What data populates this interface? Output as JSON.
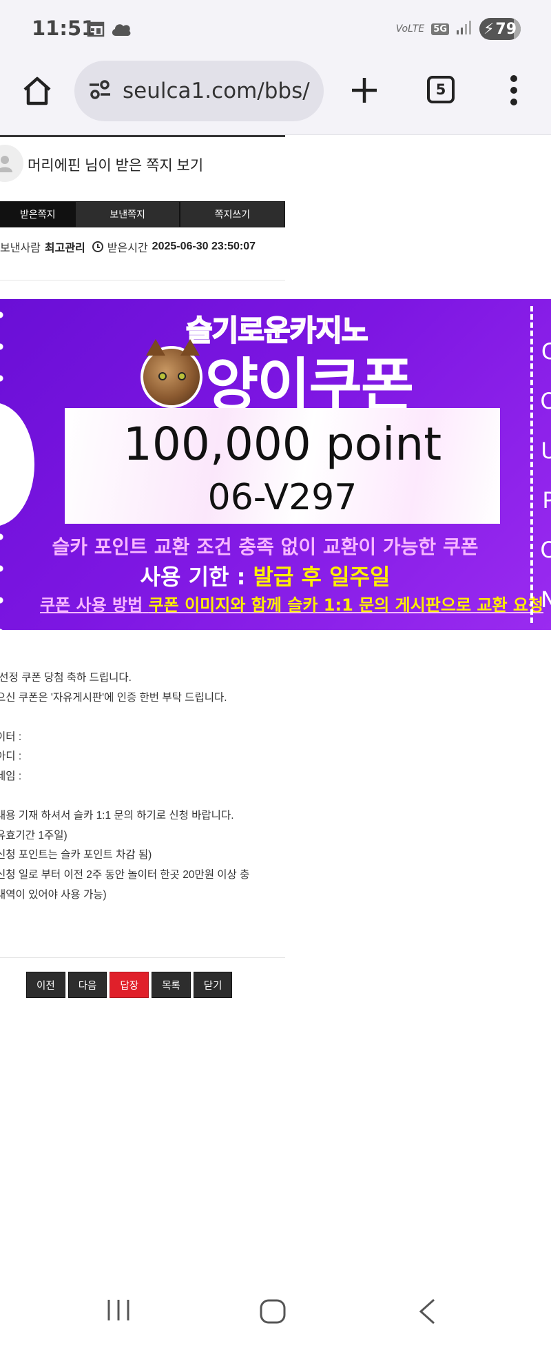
{
  "status_bar": {
    "time": "11:51",
    "volte": "VoLTE",
    "network": "5G",
    "battery": "79"
  },
  "browser": {
    "url": "seulca1.com/bbs/",
    "tab_count": "5"
  },
  "message": {
    "header_title": "머리에핀 님이 받은 쪽지 보기",
    "tabs": [
      "받은쪽지",
      "보낸쪽지",
      "쪽지쓰기"
    ],
    "sender_label": "보낸사람",
    "sender_name": "최고관리",
    "received_label": "받은시간",
    "received_time": "2025-06-30 23:50:07"
  },
  "coupon": {
    "brand": "슬기로운카지노",
    "title": "양이쿠폰",
    "amount": "100,000 point",
    "code": "06-V297",
    "line1": "슬카 포인트 교환 조건 충족 없이 교환이 가능한 쿠폰",
    "line2_label": "사용 기한 :",
    "line2_value": "발급 후 일주일",
    "line3_label": "쿠폰 사용 방법",
    "line3_value": "쿠폰 이미지와 함께 슬카 1:1 문의 게시판으로 교환 요청",
    "stub_text": "COUPON"
  },
  "body_lines": [
    " 선정 쿠폰 당첨 축하 드립니다.",
    "으신 쿠폰은 '자유게시판'에 인증 한번 부탁 드립니다.",
    "",
    "이터 :",
    "아디 :",
    "네임 :",
    "",
    "내용 기재 하셔서 슬카 1:1 문의 하기로 신청 바랍니다.",
    "유효기간 1주일)",
    "신청 포인트는 슬카 포인트 차감 됨)",
    "신청 일로 부터 이전 2주 동안 놀이터 한곳 20만원 이상 충",
    "내역이 있어야 사용 가능)"
  ],
  "buttons": {
    "prev": "이전",
    "next": "다음",
    "reply": "답장",
    "list": "목록",
    "close": "닫기"
  },
  "colors": {
    "coupon_purple": "#7d16e2",
    "reply_red": "#e0202a",
    "brand_red": "#ff2a2a",
    "highlight_yellow": "#ffee00"
  }
}
